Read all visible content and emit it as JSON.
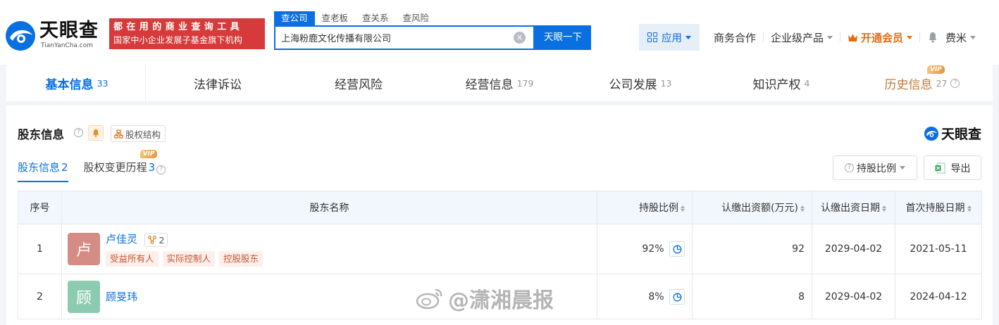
{
  "header": {
    "logo_title": "天眼查",
    "logo_sub": "TianYanCha.com",
    "slogan_line1": "都在用的商业查询工具",
    "slogan_line2": "国家中小企业发展子基金旗下机构",
    "search_tabs": [
      "查公司",
      "查老板",
      "查关系",
      "查风险"
    ],
    "search_value": "上海粉鹿文化传播有限公司",
    "search_button": "天眼一下",
    "nav_app": "应用",
    "nav_business": "商务合作",
    "nav_enterprise": "企业级产品",
    "nav_vip": "开通会员",
    "nav_user": "费米"
  },
  "tabs": [
    {
      "label": "基本信息",
      "count": "33"
    },
    {
      "label": "法律诉讼",
      "count": ""
    },
    {
      "label": "经营风险",
      "count": ""
    },
    {
      "label": "经营信息",
      "count": "179"
    },
    {
      "label": "公司发展",
      "count": "13"
    },
    {
      "label": "知识产权",
      "count": "4"
    },
    {
      "label": "历史信息",
      "count": "27"
    }
  ],
  "vip_badge": "VIP",
  "section": {
    "title": "股东信息",
    "structure_button": "股权结构",
    "brand": "天眼查",
    "subtabs": [
      {
        "label": "股东信息",
        "count": "2"
      },
      {
        "label": "股权变更历程",
        "count": "3"
      }
    ],
    "hold_ratio_button": "持股比例",
    "export_button": "导出"
  },
  "table": {
    "headers": [
      "序号",
      "股东名称",
      "持股比例",
      "认缴出资额(万元)",
      "认缴出资日期",
      "首次持股日期"
    ],
    "rows": [
      {
        "index": "1",
        "avatar": "卢",
        "avatar_color": "#d48c85",
        "name": "卢佳灵",
        "relations": "2",
        "tags": [
          "受益所有人",
          "实际控制人",
          "控股股东"
        ],
        "ratio": "92%",
        "amount": "92",
        "subscribe_date": "2029-04-02",
        "first_date": "2021-05-11"
      },
      {
        "index": "2",
        "avatar": "顾",
        "avatar_color": "#8ccbb0",
        "name": "顾旻玮",
        "relations": "",
        "tags": [],
        "ratio": "8%",
        "amount": "8",
        "subscribe_date": "2029-04-02",
        "first_date": "2024-04-12"
      }
    ]
  },
  "watermark": "@潇湘晨报",
  "colors": {
    "primary": "#0a6fe0",
    "slogan_bg": "#d63a3a",
    "vip": "#e36d0e",
    "tag_text": "#c7532e"
  }
}
